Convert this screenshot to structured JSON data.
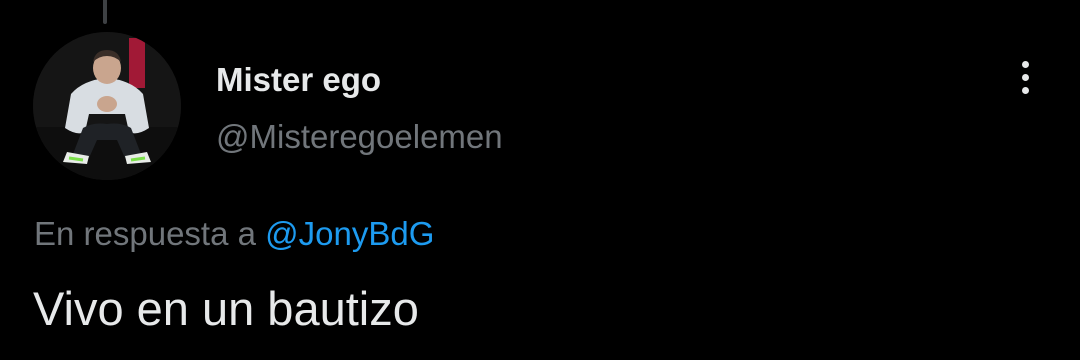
{
  "tweet": {
    "author": {
      "display_name": "Mister ego",
      "handle": "@Misteregoelemen",
      "avatar_icon": "profile-photo"
    },
    "reply_context": {
      "prefix": "En respuesta a",
      "mention": "@JonyBdG"
    },
    "text": "Vivo en un bautizo",
    "more_icon": "vertical-ellipsis-icon"
  },
  "colors": {
    "background": "#000000",
    "primary_text": "#e7e9ea",
    "secondary_text": "#71767b",
    "link": "#1d9bf0"
  }
}
